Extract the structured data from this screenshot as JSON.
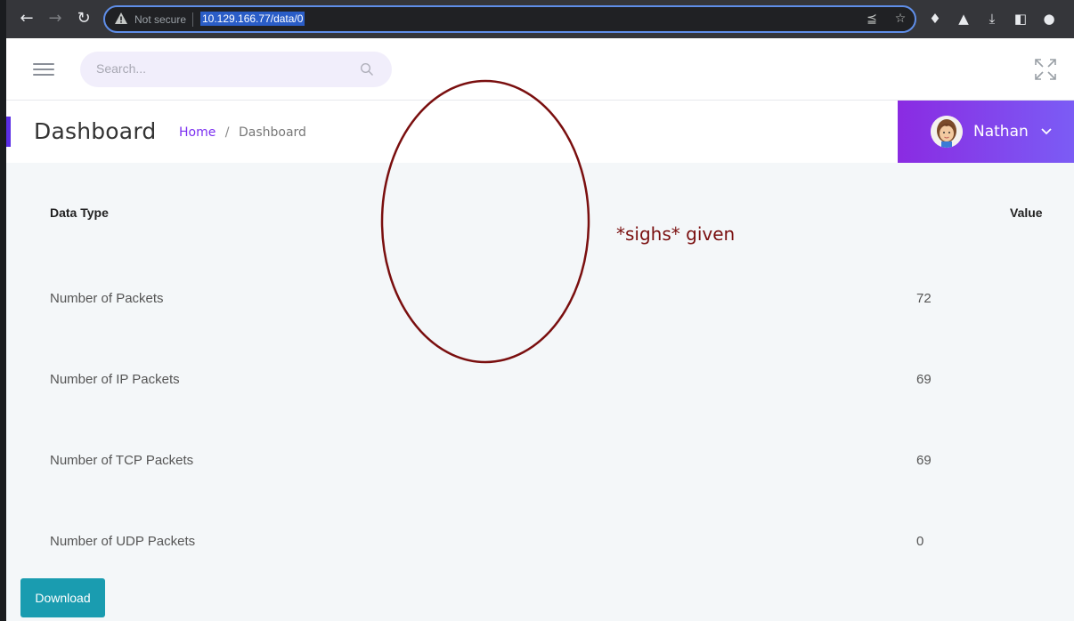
{
  "browser": {
    "security_label": "Not secure",
    "url": "10.129.166.77/data/0"
  },
  "topbar": {
    "search_placeholder": "Search..."
  },
  "header": {
    "title": "Dashboard",
    "breadcrumb": [
      "Home",
      "/",
      "Dashboard"
    ],
    "user_name": "Nathan",
    "accent_color": "#5b2ee6",
    "user_gradient": [
      "#8a2be2",
      "#7b5cf5"
    ]
  },
  "table": {
    "headers": [
      "Data Type",
      "Value"
    ],
    "rows": [
      {
        "label": "Number of Packets",
        "value": "72"
      },
      {
        "label": "Number of IP Packets",
        "value": "69"
      },
      {
        "label": "Number of TCP Packets",
        "value": "69"
      },
      {
        "label": "Number of UDP Packets",
        "value": "0"
      }
    ]
  },
  "actions": {
    "download_label": "Download",
    "download_color": "#1a9cb0"
  },
  "annotation": {
    "text": "*sighs* given",
    "color": "#7a0f0f"
  }
}
